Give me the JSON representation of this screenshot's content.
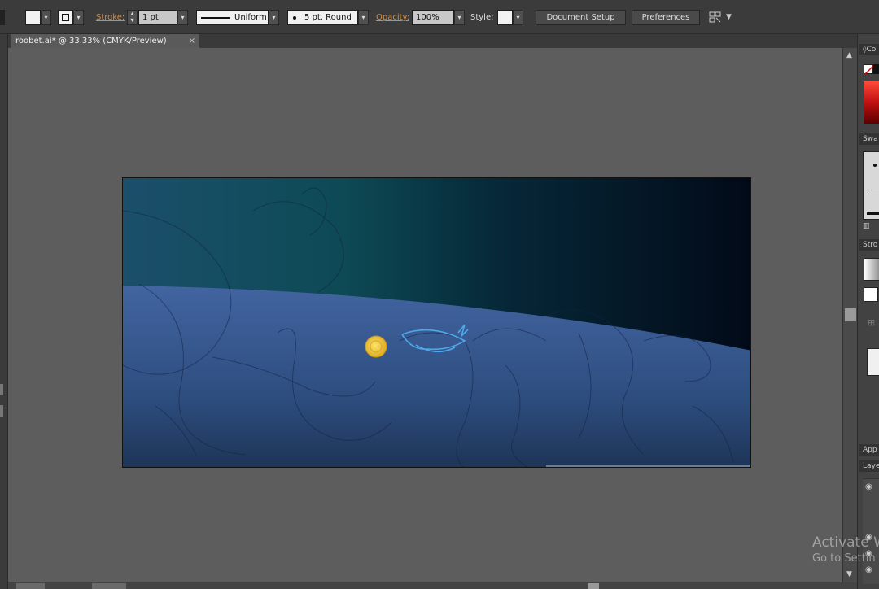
{
  "control_bar": {
    "stroke_label": "Stroke:",
    "stroke_weight": "1 pt",
    "stroke_profile": "Uniform",
    "brush": "5 pt. Round",
    "opacity_label": "Opacity:",
    "opacity_value": "100%",
    "style_label": "Style:",
    "document_setup_label": "Document Setup",
    "preferences_label": "Preferences"
  },
  "document": {
    "tab_title": "roobet.ai* @ 33.33% (CMYK/Preview)",
    "close_glyph": "×"
  },
  "panels": {
    "color_title": "Co",
    "swatches_title": "Swa",
    "stroke_title": "Stro",
    "appearance_title": "App",
    "layers_title": "Laye"
  },
  "watermark": {
    "line1": "Activate W",
    "line2": "Go to Settin"
  },
  "colors": {
    "accent_orange": "#e08a2a",
    "space_dark": "#020a18",
    "space_teal": "#0d4a55",
    "planet_blue": "#3e5f92",
    "coin_gold": "#f1c232"
  }
}
